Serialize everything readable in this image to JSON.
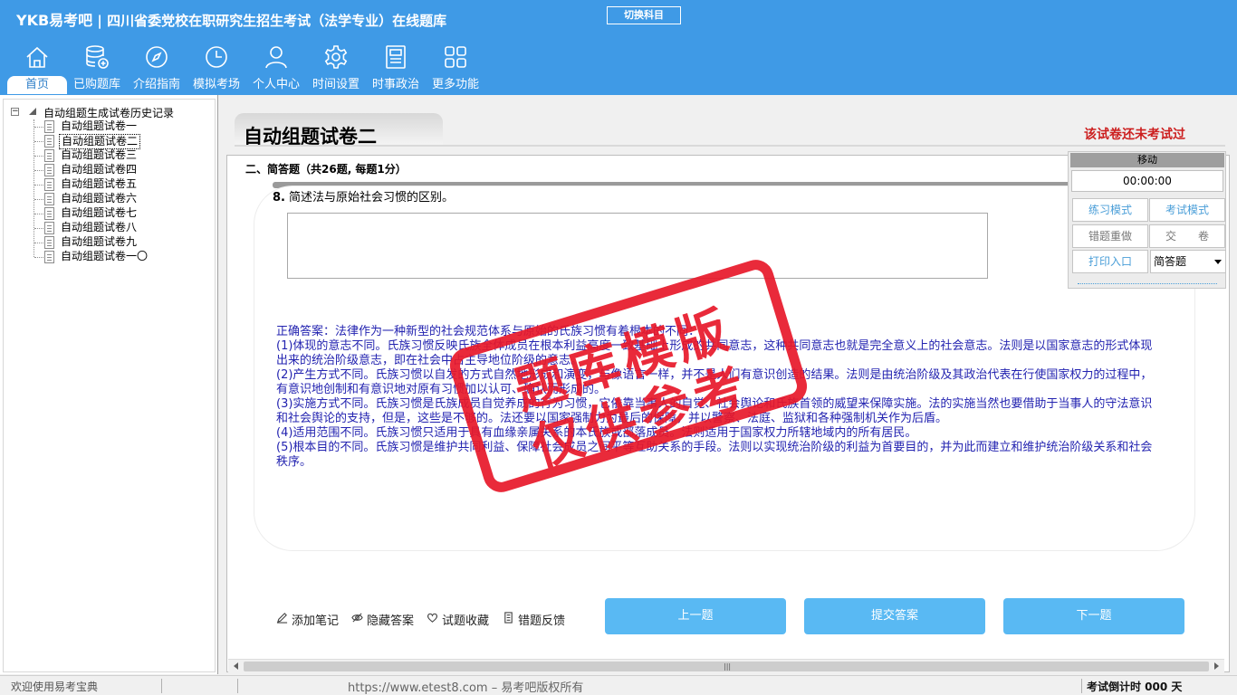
{
  "app": {
    "brand": "YKB易考吧",
    "title": "四川省委党校在职研究生招生考试（法学专业）在线题库",
    "switch_label": "切换科目"
  },
  "nav": {
    "items": [
      {
        "label": "首页",
        "icon": "home-icon"
      },
      {
        "label": "已购题库",
        "icon": "database-add-icon"
      },
      {
        "label": "介绍指南",
        "icon": "compass-icon"
      },
      {
        "label": "模拟考场",
        "icon": "clock-icon"
      },
      {
        "label": "个人中心",
        "icon": "user-icon"
      },
      {
        "label": "时间设置",
        "icon": "gear-icon"
      },
      {
        "label": "时事政治",
        "icon": "newspaper-icon"
      },
      {
        "label": "更多功能",
        "icon": "grid-icon"
      }
    ]
  },
  "tree": {
    "root": "自动组题生成试卷历史记录",
    "items": [
      "自动组题试卷一",
      "自动组题试卷二",
      "自动组题试卷三",
      "自动组题试卷四",
      "自动组题试卷五",
      "自动组题试卷六",
      "自动组题试卷七",
      "自动组题试卷八",
      "自动组题试卷九",
      "自动组题试卷一〇"
    ],
    "selected_index": 1
  },
  "paper": {
    "title": "自动组题试卷二",
    "status": "该试卷还未考试过",
    "section": "二、简答题（共26题, 每题1分）"
  },
  "question": {
    "number": "8.",
    "text": "简述法与原始社会习惯的区别。",
    "answer_lines": [
      "正确答案：法律作为一种新型的社会规范体系与原始的氏族习惯有着根本的不同：",
      "(1)体现的意志不同。氏族习惯反映氏族全体成员在根本利益高度一致基础上形成的共同意志，这种共同意志也就是完全意义上的社会意志。法则是以国家意志的形式体现出来的统治阶级意志，即在社会中占主导地位阶级的意志。",
      "(2)产生方式不同。氏族习惯以自发的方式自然地形成和演变，与像语言一样，并不是人们有意识创造的结果。法则是由统治阶级及其政治代表在行使国家权力的过程中，有意识地创制和有意识地对原有习惯加以认可、确认而形成的。",
      "(3)实施方式不同。氏族习惯是氏族成员自觉养成的行为习惯，它依靠当事人的自觉、社会舆论和氏族首领的威望来保障实施。法的实施当然也要借助于当事人的守法意识和社会舆论的支持，但是，这些是不够的。法还要以国家强制力为最后的保障，并以警察、法庭、监狱和各种强制机关作为后盾。",
      "(4)适用范围不同。氏族习惯只适用于具有血缘亲属关系的本氏族或部落成员。法则适用于国家权力所辖地域内的所有居民。",
      "(5)根本目的不同。氏族习惯是维护共同利益、保障社会成员之间平等互助关系的手段。法则以实现统治阶级的利益为首要目的，并为此而建立和维护统治阶级关系和社会秩序。"
    ]
  },
  "stamp": {
    "line1": "题库模版",
    "line2": "仅供参考",
    "color": "#e8182a"
  },
  "control": {
    "move": "移动",
    "timer": "00:00:00",
    "practice_mode": "练习模式",
    "exam_mode": "考试模式",
    "redo_wrong": "错题重做",
    "submit_paper": "交　　卷",
    "print": "打印入口",
    "type_selected": "简答题"
  },
  "toolbar": {
    "add_note": "添加笔记",
    "hide_answer": "隐藏答案",
    "favorite": "试题收藏",
    "feedback": "错题反馈",
    "prev": "上一题",
    "submit_answer": "提交答案",
    "next": "下一题"
  },
  "statusbar": {
    "welcome": "欢迎使用易考宝典",
    "url": "https://www.etest8.com – 易考吧版权所有",
    "countdown": "考试倒计时 000 天"
  },
  "colors": {
    "header_bg": "#3f9ae6",
    "button_blue": "#59b9f3",
    "status_red": "#cc1f1f",
    "answer_blue": "#2323b0"
  }
}
